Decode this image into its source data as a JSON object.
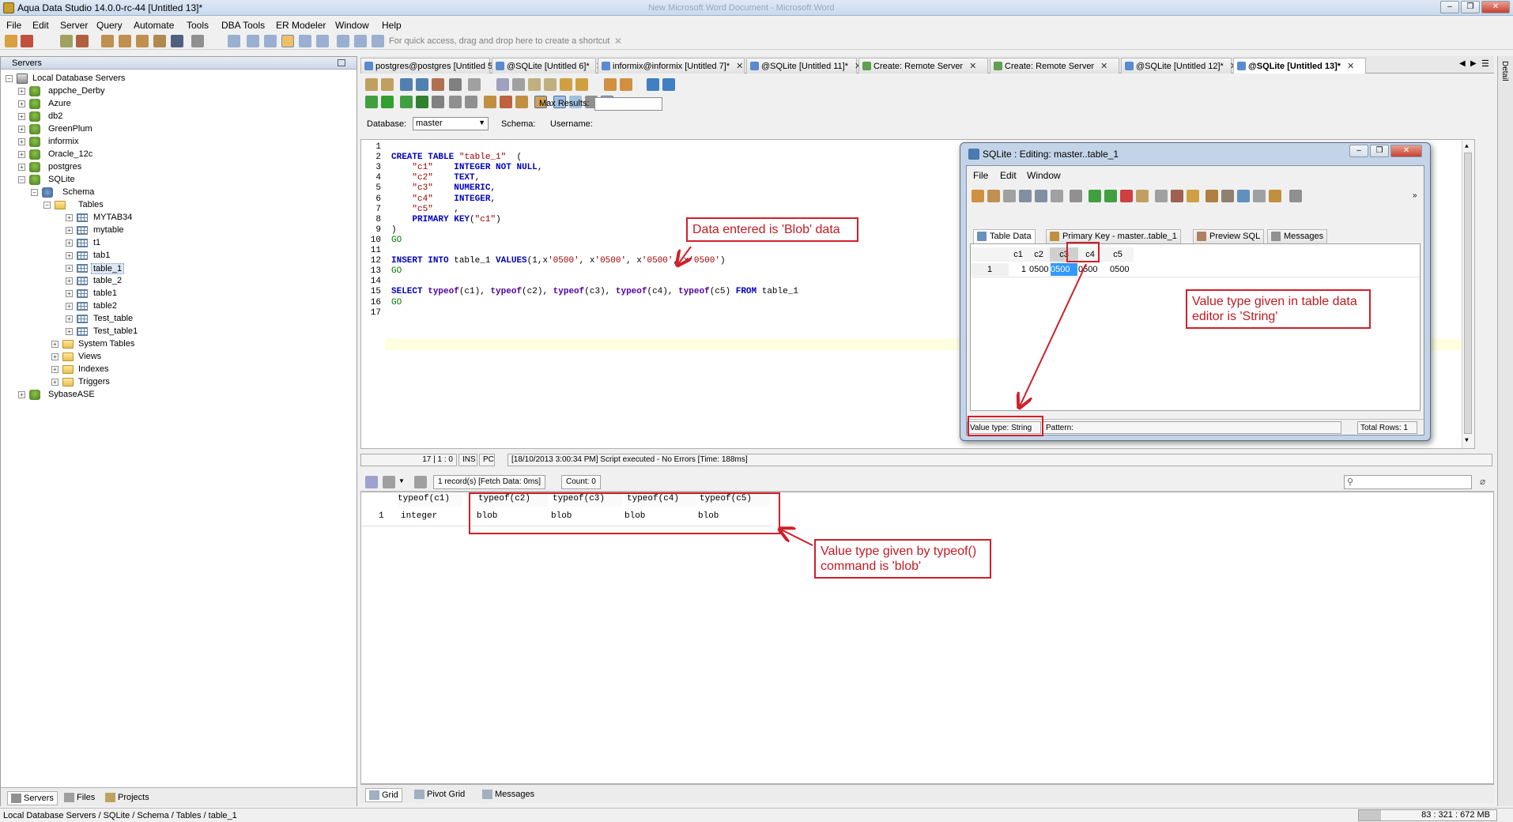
{
  "app": {
    "title": "Aqua Data Studio 14.0.0-rc-44 [Untitled 13]*",
    "faded_title": "New Microsoft Word Document - Microsoft Word",
    "window_buttons": [
      "–",
      "❐",
      "✕"
    ]
  },
  "menu": [
    "File",
    "Edit",
    "Server",
    "Query",
    "Automate",
    "Tools",
    "DBA Tools",
    "ER Modeler",
    "Window",
    "Help"
  ],
  "toolbar": {
    "shortcut_hint": "For quick access, drag and drop here to create a shortcut"
  },
  "servers": {
    "header": "Servers",
    "tree": [
      {
        "label": "Local Database Servers",
        "icon": "server-icon"
      },
      {
        "label": "appche_Derby",
        "icon": "database-icon"
      },
      {
        "label": "Azure",
        "icon": "database-icon"
      },
      {
        "label": "db2",
        "icon": "database-icon"
      },
      {
        "label": "GreenPlum",
        "icon": "database-icon"
      },
      {
        "label": "informix",
        "icon": "database-icon"
      },
      {
        "label": "Oracle_12c",
        "icon": "database-icon"
      },
      {
        "label": "postgres",
        "icon": "database-icon"
      },
      {
        "label": "SQLite",
        "icon": "database-icon"
      },
      {
        "label": "Schema",
        "icon": "database-icon"
      },
      {
        "label": "Tables",
        "icon": "folder-icon"
      },
      {
        "label": "MYTAB34",
        "icon": "table-icon"
      },
      {
        "label": "mytable",
        "icon": "table-icon"
      },
      {
        "label": "t1",
        "icon": "table-icon"
      },
      {
        "label": "tab1",
        "icon": "table-icon"
      },
      {
        "label": "table_1",
        "icon": "table-icon"
      },
      {
        "label": "table_2",
        "icon": "table-icon"
      },
      {
        "label": "table1",
        "icon": "table-icon"
      },
      {
        "label": "table2",
        "icon": "table-icon"
      },
      {
        "label": "Test_table",
        "icon": "table-icon"
      },
      {
        "label": "Test_table1",
        "icon": "table-icon"
      },
      {
        "label": "System Tables",
        "icon": "folder-icon"
      },
      {
        "label": "Views",
        "icon": "folder-icon"
      },
      {
        "label": "Indexes",
        "icon": "folder-icon"
      },
      {
        "label": "Triggers",
        "icon": "folder-icon"
      },
      {
        "label": "SybaseASE",
        "icon": "database-icon"
      }
    ],
    "bottom_tabs": [
      "Servers",
      "Files",
      "Projects"
    ]
  },
  "editor_tabs": [
    "postgres@postgres [Untitled 5]*",
    "@SQLite [Untitled 6]*",
    "informix@informix [Untitled 7]*",
    "@SQLite [Untitled 11]*",
    "Create: Remote Server",
    "Create: Remote Server",
    "@SQLite [Untitled 12]*",
    "@SQLite [Untitled 13]*"
  ],
  "query_bar": {
    "database_label": "Database:",
    "database_value": "master",
    "schema_label": "Schema:",
    "username_label": "Username:",
    "max_results_label": "Max Results:"
  },
  "code_lines": [
    "",
    "CREATE TABLE \"table_1\"  (",
    "    \"c1\"    INTEGER NOT NULL,",
    "    \"c2\"    TEXT,",
    "    \"c3\"    NUMERIC,",
    "    \"c4\"    INTEGER,",
    "    \"c5\"    ,",
    "    PRIMARY KEY(\"c1\")",
    ")",
    "GO",
    "",
    "INSERT INTO table_1 VALUES(1,x'0500', x'0500', x'0500', x'0500')",
    "GO",
    "",
    "SELECT typeof(c1), typeof(c2), typeof(c3), typeof(c4), typeof(c5) FROM table_1",
    "GO",
    ""
  ],
  "status": {
    "position": "17 | 1 : 0",
    "mode": "INS",
    "platform": "PC",
    "message": "[18/10/2013 3:00:34 PM] Script executed - No Errors [Time: 188ms]"
  },
  "results": {
    "records": "1 record(s) [Fetch Data: 0ms]",
    "count": "Count: 0",
    "columns": [
      "typeof(c1)",
      "typeof(c2)",
      "typeof(c3)",
      "typeof(c4)",
      "typeof(c5)"
    ],
    "rows": [
      {
        "num": "1",
        "cells": [
          "integer",
          "blob",
          "blob",
          "blob",
          "blob"
        ]
      }
    ],
    "bottom_tabs": [
      "Grid",
      "Pivot Grid",
      "Messages"
    ]
  },
  "right_strip": "Detail",
  "app_status": {
    "path": "Local Database Servers / SQLite / Schema / Tables / table_1",
    "memory": "83 : 321 : 672 MB"
  },
  "float_window": {
    "title": "SQLite : Editing: master..table_1",
    "menu": [
      "File",
      "Edit",
      "Window"
    ],
    "tabs": [
      "Table Data",
      "Primary Key - master..table_1",
      "Preview SQL",
      "Messages"
    ],
    "columns": [
      "c1",
      "c2",
      "c3",
      "c4",
      "c5"
    ],
    "row": {
      "num": "1",
      "cells": [
        "1",
        "0500",
        "0500",
        "0500",
        "0500"
      ]
    },
    "value_type": "Value type: String",
    "pattern": "Pattern:",
    "total_rows": "Total Rows: 1"
  },
  "annotations": {
    "blob_data": "Data entered is 'Blob' data",
    "string_type": "Value type given in table data editor is 'String'",
    "typeof_blob": "Value type given by typeof() command is 'blob'"
  },
  "colors": {
    "annotation_red": "#d0202a",
    "keyword_blue": "#0000c0",
    "string_red": "#a00000",
    "go_green": "#008000",
    "selection_blue": "#3399ff"
  }
}
